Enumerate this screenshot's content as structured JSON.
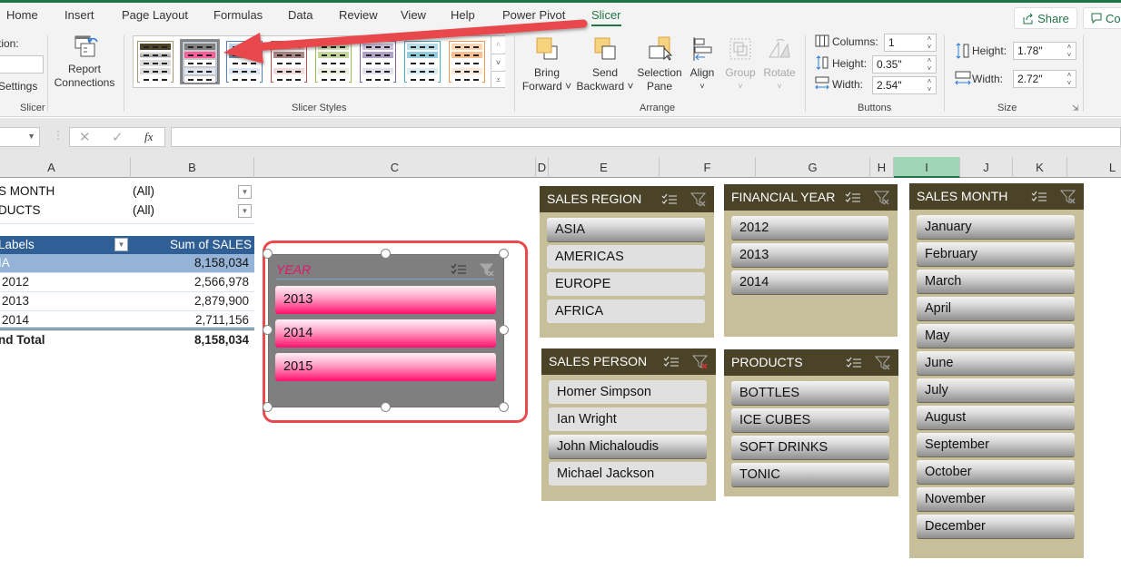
{
  "ribbon_tabs": [
    "Home",
    "Insert",
    "Page Layout",
    "Formulas",
    "Data",
    "Review",
    "View",
    "Help",
    "Power Pivot",
    "Slicer"
  ],
  "active_tab": "Slicer",
  "share_label": "Share",
  "comments_label": "Co",
  "ribbon": {
    "slicer_group": {
      "caption_label": "tion:",
      "settings_label": "Settings",
      "report_connections_line1": "Report",
      "report_connections_line2": "Connections",
      "group_label": "Slicer"
    },
    "styles_group": {
      "group_label": "Slicer Styles",
      "selected_style_index": 1
    },
    "arrange_group": {
      "bring_forward_1": "Bring",
      "bring_forward_2": "Forward ˅",
      "send_backward_1": "Send",
      "send_backward_2": "Backward ˅",
      "selection_pane_1": "Selection",
      "selection_pane_2": "Pane",
      "align": "Align",
      "group": "Group",
      "rotate": "Rotate",
      "group_label": "Arrange"
    },
    "buttons_group": {
      "columns_label": "Columns:",
      "columns_value": "1",
      "height_label": "Height:",
      "height_value": "0.35\"",
      "width_label": "Width:",
      "width_value": "2.54\"",
      "group_label": "Buttons"
    },
    "size_group": {
      "height_label": "Height:",
      "height_value": "1.78\"",
      "width_label": "Width:",
      "width_value": "2.72\"",
      "group_label": "Size"
    }
  },
  "formula_bar": {
    "fx_label": "fx",
    "value": ""
  },
  "columns": [
    "A",
    "B",
    "C",
    "D",
    "E",
    "F",
    "G",
    "H",
    "I",
    "J",
    "K",
    "L"
  ],
  "active_column": "I",
  "pivot": {
    "filters": [
      {
        "label": "S MONTH",
        "value": "(All)"
      },
      {
        "label": "DUCTS",
        "value": "(All)"
      }
    ],
    "header_label": "Labels",
    "header_value": "Sum of SALES",
    "rows": [
      {
        "label": "IA",
        "value": "8,158,034",
        "highlight": true
      },
      {
        "label": "2012",
        "value": "2,566,978"
      },
      {
        "label": "2013",
        "value": "2,879,900"
      },
      {
        "label": "2014",
        "value": "2,711,156"
      }
    ],
    "total_label": "nd Total",
    "total_value": "8,158,034"
  },
  "year_slicer": {
    "title": "YEAR",
    "items": [
      "2013",
      "2014",
      "2015"
    ]
  },
  "slicers": {
    "sales_region": {
      "title": "SALES REGION",
      "items": [
        {
          "label": "ASIA",
          "selected": true
        },
        {
          "label": "AMERICAS",
          "selected": false
        },
        {
          "label": "EUROPE",
          "selected": false
        },
        {
          "label": "AFRICA",
          "selected": false
        }
      ]
    },
    "financial_year": {
      "title": "FINANCIAL YEAR",
      "items": [
        {
          "label": "2012",
          "selected": true
        },
        {
          "label": "2013",
          "selected": true
        },
        {
          "label": "2014",
          "selected": true
        }
      ]
    },
    "sales_person": {
      "title": "SALES PERSON",
      "items": [
        {
          "label": "Homer Simpson",
          "selected": false
        },
        {
          "label": "Ian Wright",
          "selected": false
        },
        {
          "label": "John Michaloudis",
          "selected": true
        },
        {
          "label": "Michael Jackson",
          "selected": false
        }
      ]
    },
    "products": {
      "title": "PRODUCTS",
      "items": [
        {
          "label": "BOTTLES",
          "selected": true
        },
        {
          "label": "ICE CUBES",
          "selected": true
        },
        {
          "label": "SOFT DRINKS",
          "selected": true
        },
        {
          "label": "TONIC",
          "selected": true
        }
      ]
    },
    "sales_month": {
      "title": "SALES MONTH",
      "items": [
        {
          "label": "January",
          "selected": true
        },
        {
          "label": "February",
          "selected": true
        },
        {
          "label": "March",
          "selected": true
        },
        {
          "label": "April",
          "selected": true
        },
        {
          "label": "May",
          "selected": true
        },
        {
          "label": "June",
          "selected": true
        },
        {
          "label": "July",
          "selected": true
        },
        {
          "label": "August",
          "selected": true
        },
        {
          "label": "September",
          "selected": true
        },
        {
          "label": "October",
          "selected": true
        },
        {
          "label": "November",
          "selected": true
        },
        {
          "label": "December",
          "selected": true
        }
      ]
    }
  },
  "colors": {
    "excel_green": "#217346",
    "slicer_header": "#4a4328",
    "slicer_body": "#c7bf9a",
    "pivot_header": "#2f5f95",
    "pivot_highlight": "#95b3d7",
    "year_item_pink": "#ff0f6b",
    "annotation_red": "#e84a4e"
  }
}
